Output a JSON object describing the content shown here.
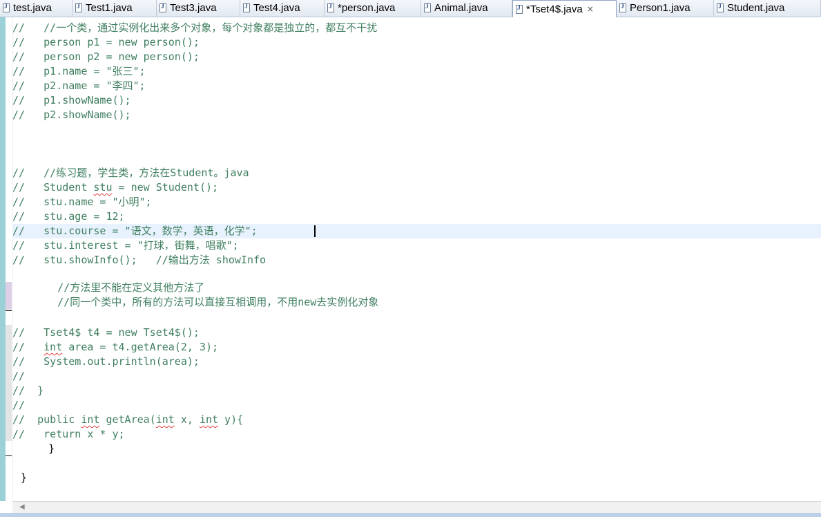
{
  "tabs": [
    {
      "label": "test.java"
    },
    {
      "label": "Test1.java"
    },
    {
      "label": "Test3.java"
    },
    {
      "label": "Test4.java"
    },
    {
      "label": "*person.java"
    },
    {
      "label": "Animal.java"
    },
    {
      "label": "*Tset4$.java",
      "active": true
    },
    {
      "label": "Person1.java"
    },
    {
      "label": "Student.java"
    }
  ],
  "active_tab_close": "×",
  "code": {
    "l1": {
      "slash": "//",
      "tail": "\t//一个类，通过实例化出来多个对象，每个对象都是独立的，都互不干扰"
    },
    "l2": {
      "slash": "//",
      "tail": "\tperson p1 = new person();"
    },
    "l3": {
      "slash": "//",
      "tail": "\tperson p2 = new person();"
    },
    "l4": {
      "slash": "//",
      "tail": "\tp1.name = \"张三\";"
    },
    "l5": {
      "slash": "//",
      "tail": "\tp2.name = \"李四\";"
    },
    "l6": {
      "slash": "//",
      "tail": "\tp1.showName();"
    },
    "l7": {
      "slash": "//",
      "tail": "\tp2.showName();"
    },
    "l8": {
      "slash": "//",
      "tail": "\t//练习题，学生类，方法在Student。java"
    },
    "l9": {
      "slash": "//",
      "pre": "\tStudent ",
      "err": "stu",
      "post": " = new Student();"
    },
    "l10": {
      "slash": "//",
      "tail": "\tstu.name = \"小明\";"
    },
    "l11": {
      "slash": "//",
      "tail": "\tstu.age = 12;"
    },
    "l12": {
      "slash": "//",
      "tail": "\tstu.course = \"语文，数学，英语，化学\";"
    },
    "l13": {
      "slash": "//",
      "tail": "\tstu.interest = \"打球，街舞，唱歌\";"
    },
    "l14": {
      "slash": "//",
      "tail": "\tstu.showInfo();   //输出方法 showInfo"
    },
    "l15": {
      "tail": "\t//方法里不能在定义其他方法了"
    },
    "l16": {
      "tail": "\t//同一个类中，所有的方法可以直接互相调用，不用new去实例化对象"
    },
    "l17": {
      "slash": "//",
      "tail": "\tTset4$ t4 = new Tset4$();"
    },
    "l18": {
      "slash": "//",
      "pre": "\t",
      "err": "int",
      "post": " area = t4.getArea(2, 3);"
    },
    "l19": {
      "slash": "//",
      "tail": "\tSystem.out.println(area);"
    },
    "l20": {
      "slash": "//",
      "tail": ""
    },
    "l21": {
      "slash": "//",
      "tail": "  }"
    },
    "l22": {
      "slash": "//",
      "tail": ""
    },
    "l23": {
      "slash": "//",
      "p1": "  public ",
      "e1": "int",
      "p2": " getArea(",
      "e2": "int",
      "p3": " x, ",
      "e3": "int",
      "p4": " y){"
    },
    "l24": {
      "slash": "//",
      "tail": "\treturn x * y;"
    },
    "l25": {
      "tail": "    }"
    },
    "l26": {
      "tail": "}"
    }
  }
}
